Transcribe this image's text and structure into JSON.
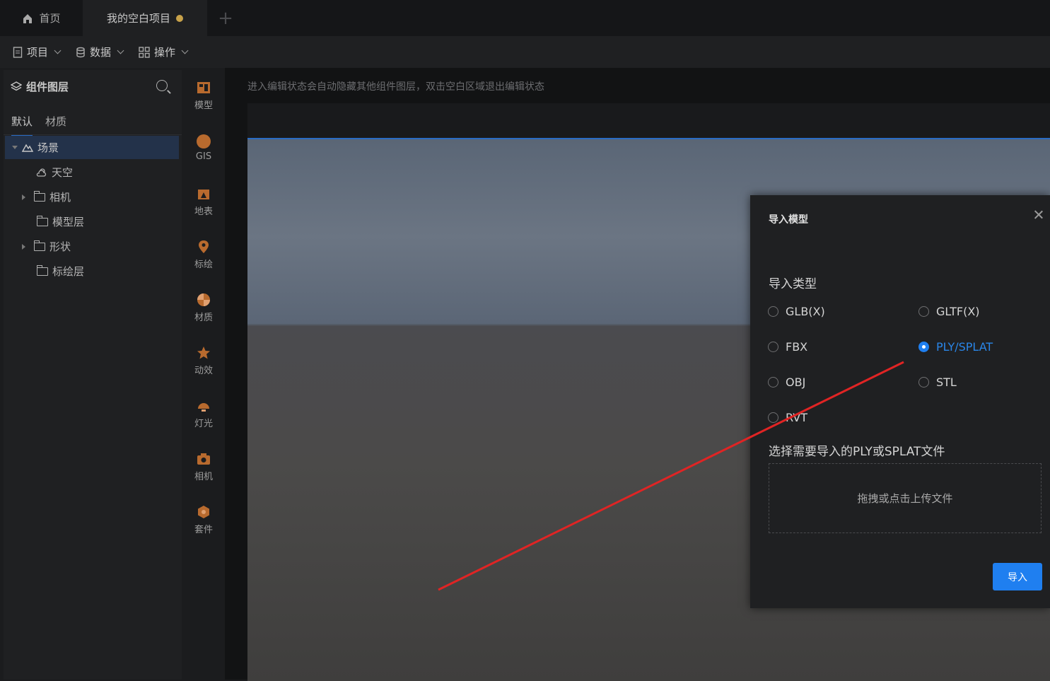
{
  "tabs": {
    "home": "首页",
    "project": "我的空白项目",
    "add": "+"
  },
  "toolbar": {
    "project": "项目",
    "data": "数据",
    "actions": "操作"
  },
  "layers": {
    "title": "组件图层",
    "tabs": [
      "默认",
      "材质"
    ],
    "tree": [
      "场景",
      "天空",
      "相机",
      "模型层",
      "形状",
      "标绘层"
    ]
  },
  "components": [
    "模型",
    "GIS",
    "地表",
    "标绘",
    "材质",
    "动效",
    "灯光",
    "相机",
    "套件"
  ],
  "canvas": {
    "hint": "进入编辑状态会自动隐藏其他组件图层，双击空白区域退出编辑状态"
  },
  "dialog": {
    "title": "导入模型",
    "type_label": "导入类型",
    "options": [
      "GLB(X)",
      "GLTF(X)",
      "FBX",
      "PLY/SPLAT",
      "OBJ",
      "STL",
      "RVT"
    ],
    "selected": "PLY/SPLAT",
    "file_label": "选择需要导入的PLY或SPLAT文件",
    "dropzone": "拖拽或点击上传文件",
    "import_button": "导入"
  },
  "colors": {
    "accent": "#1f7ff0",
    "annotation": "#e02424",
    "icon": "#b86a2e"
  }
}
